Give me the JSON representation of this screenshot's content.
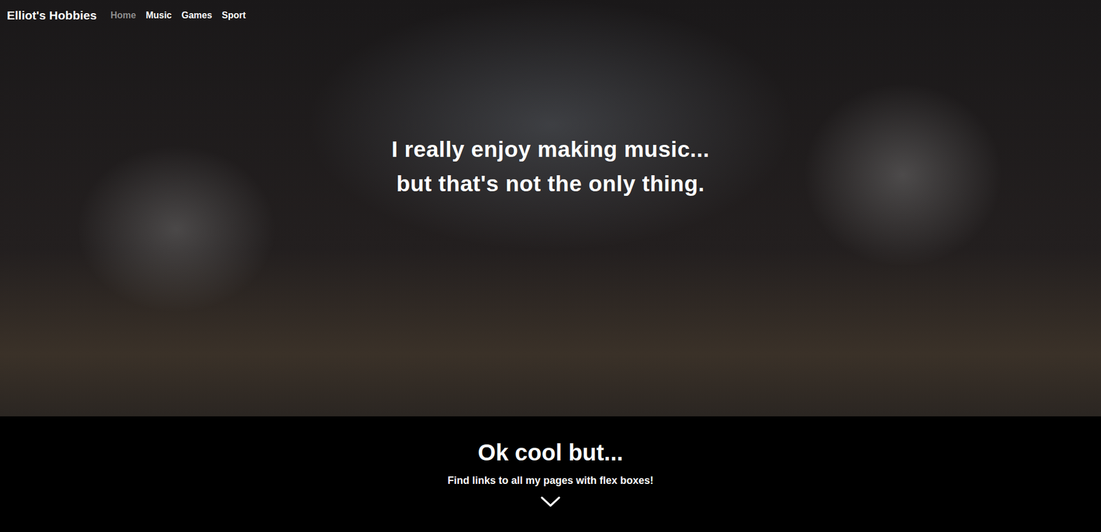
{
  "nav": {
    "brand": "Elliot's Hobbies",
    "links": [
      {
        "label": "Home",
        "selected": true
      },
      {
        "label": "Music",
        "selected": false
      },
      {
        "label": "Games",
        "selected": false
      },
      {
        "label": "Sport",
        "selected": false
      }
    ]
  },
  "hero": {
    "lines": [
      "I really enjoy making music...",
      "but that's not the only thing."
    ]
  },
  "section": {
    "title": "Ok cool but...",
    "subtitle": "Find links to all my pages with flex boxes!"
  }
}
